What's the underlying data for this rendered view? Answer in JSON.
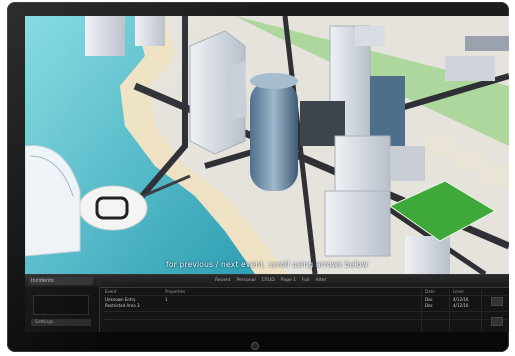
{
  "ticker": {
    "text": "for previous / next event, scroll using arrows below"
  },
  "panel": {
    "left_title": "Incidents",
    "left_button": "Settings",
    "tabs": [
      "Recent",
      "Personal",
      "CRUD",
      "Page 1",
      "Full",
      "Alter"
    ],
    "columns": [
      "Event",
      "Properties",
      "Date",
      "Level"
    ],
    "rows": [
      {
        "event": "Unknown Entry",
        "props": "1",
        "date": "Dec",
        "level": "4/12/16"
      },
      {
        "event": "Restricted Area 3",
        "props": "",
        "date": "Dec",
        "level": "4/12/16"
      }
    ]
  },
  "colors": {
    "water": "#5cc6d4",
    "grass": "#3ea83b",
    "road": "#2e3035",
    "building": "#d6dbe2",
    "bezel": "#0f0f0f"
  }
}
